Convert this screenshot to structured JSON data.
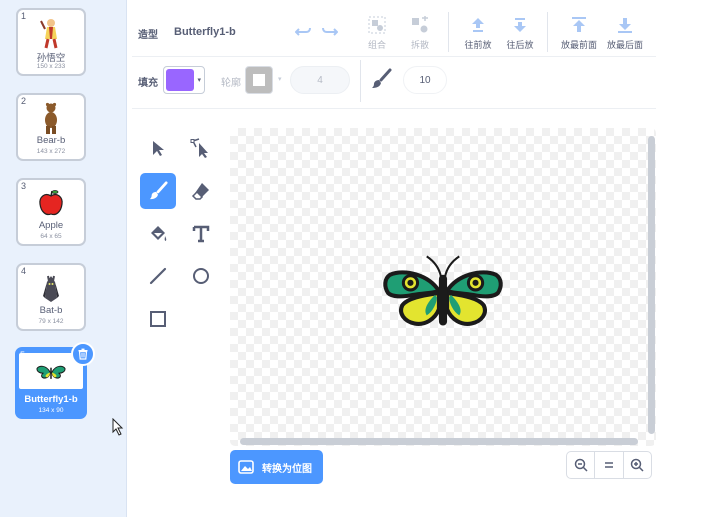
{
  "costumes": [
    {
      "number": "1",
      "name": "孙悟空",
      "size": "150 x 233",
      "icon": "monkey-king-icon"
    },
    {
      "number": "2",
      "name": "Bear-b",
      "size": "143 x 272",
      "icon": "bear-icon"
    },
    {
      "number": "3",
      "name": "Apple",
      "size": "64 x 65",
      "icon": "apple-icon"
    },
    {
      "number": "4",
      "name": "Bat-b",
      "size": "79 x 142",
      "icon": "bat-icon"
    },
    {
      "number": "5",
      "name": "Butterfly1-b",
      "size": "134 x 90",
      "icon": "butterfly-icon",
      "selected": true
    }
  ],
  "toolbar": {
    "costume_label": "造型",
    "costume_name": "Butterfly1-b",
    "group_label": "组合",
    "ungroup_label": "拆散",
    "forward_label": "往前放",
    "backward_label": "往后放",
    "front_label": "放最前面",
    "back_label": "放最后面"
  },
  "properties": {
    "fill_label": "填充",
    "fill_color": "#9966ff",
    "outline_label": "轮廓",
    "outline_width": "4",
    "brush_size": "10"
  },
  "tools": [
    "select-tool",
    "reshape-tool",
    "brush-tool",
    "eraser-tool",
    "fill-tool",
    "text-tool",
    "line-tool",
    "circle-tool",
    "rectangle-tool"
  ],
  "active_tool": "brush-tool",
  "convert_button": "转换为位图",
  "zoom": {
    "out": "zoom-out-icon",
    "reset": "zoom-reset-icon",
    "in": "zoom-in-icon"
  },
  "colors": {
    "accent": "#4c97ff",
    "panel_bg": "#e9f1fc",
    "text": "#575e75"
  }
}
